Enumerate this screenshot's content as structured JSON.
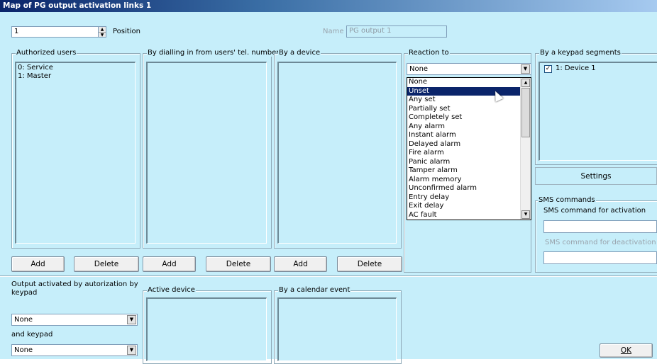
{
  "window": {
    "title": "Map of PG output activation links 1"
  },
  "position": {
    "value": "1",
    "label": "Position"
  },
  "name": {
    "label": "Name",
    "value": "PG output 1"
  },
  "authorized_users": {
    "title": "Authorized users",
    "items": [
      "0: Service",
      "1: Master"
    ],
    "add_label": "Add",
    "delete_label": "Delete"
  },
  "dialling": {
    "title": "By dialling in from users' tel. numbers",
    "add_label": "Add",
    "delete_label": "Delete"
  },
  "by_device": {
    "title": "By a device",
    "add_label": "Add",
    "delete_label": "Delete"
  },
  "reaction": {
    "title": "Reaction to",
    "selected": "None",
    "options": [
      "None",
      "Unset",
      "Any set",
      "Partially set",
      "Completely set",
      "Any alarm",
      "Instant alarm",
      "Delayed alarm",
      "Fire alarm",
      "Panic alarm",
      "Tamper alarm",
      "Alarm memory",
      "Unconfirmed alarm",
      "Entry delay",
      "Exit delay",
      "AC fault"
    ],
    "highlighted": "Unset"
  },
  "keypad_segments": {
    "title": "By a keypad segments",
    "items": [
      {
        "label": "1: Device 1",
        "checked": true
      }
    ],
    "settings_label": "Settings"
  },
  "sms": {
    "title": "SMS commands",
    "activation_label": "SMS command for activation",
    "activation_value": "",
    "deactivation_label": "SMS command for deactivation",
    "deactivation_value": ""
  },
  "keypad_auth": {
    "label": "Output activated by autorization by keypad",
    "value": "None",
    "and_keypad_label": "and keypad",
    "and_keypad_value": "None"
  },
  "active_device": {
    "title": "Active device"
  },
  "calendar": {
    "title": "By a calendar event"
  },
  "ok_label": "OK"
}
